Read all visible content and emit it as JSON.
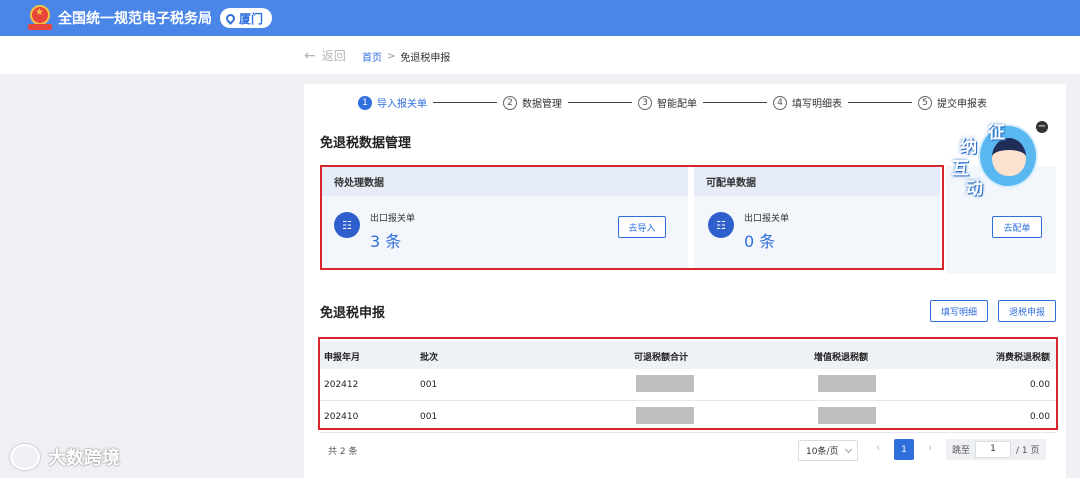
{
  "app": {
    "title": "全国统一规范电子税务局",
    "city": "厦门"
  },
  "nav": {
    "back_label": "返回",
    "breadcrumb": [
      "首页",
      ">",
      "免退税申报"
    ]
  },
  "steps": [
    {
      "num": "1",
      "label": "导入报关单",
      "active": true
    },
    {
      "num": "2",
      "label": "数据管理",
      "active": false
    },
    {
      "num": "3",
      "label": "智能配单",
      "active": false
    },
    {
      "num": "4",
      "label": "填写明细表",
      "active": false
    },
    {
      "num": "5",
      "label": "提交申报表",
      "active": false
    }
  ],
  "data_mgmt": {
    "title": "免退税数据管理",
    "pending": {
      "header": "待处理数据",
      "icon": "customs-doc-icon",
      "item_label": "出口报关单",
      "count": "3 条",
      "button": "去导入"
    },
    "matchable": {
      "header": "可配单数据",
      "icon": "customs-doc-icon",
      "item_label": "出口报关单",
      "count": "0 条",
      "button": "去配单"
    },
    "extra_button": "去配单"
  },
  "declaration": {
    "title": "免退税申报",
    "buttons": {
      "fill_detail": "填写明细",
      "refund_declare": "退税申报"
    },
    "columns": [
      "申报年月",
      "批次",
      "可退税额合计",
      "增值税退税额",
      "消费税退税额"
    ],
    "rows": [
      {
        "period": "202412",
        "batch": "001",
        "refundable_total": "",
        "vat_refund": "",
        "consumption_tax_refund": "0.00"
      },
      {
        "period": "202410",
        "batch": "001",
        "refundable_total": "",
        "vat_refund": "",
        "consumption_tax_refund": "0.00"
      }
    ]
  },
  "pagination": {
    "total": "共 2 条",
    "page_size": "10条/页",
    "prev": "‹",
    "current": "1",
    "next": "›",
    "jump_prefix": "跳至",
    "jump_value": "1",
    "jump_suffix": "/ 1 页"
  },
  "mascot": {
    "chars": [
      "征",
      "纳",
      "互",
      "动"
    ],
    "close": "−"
  },
  "watermark": "大数跨境",
  "colors": {
    "primary": "#2f6fdc",
    "topbar": "#4a86e8",
    "highlight_border": "#d9262e"
  }
}
